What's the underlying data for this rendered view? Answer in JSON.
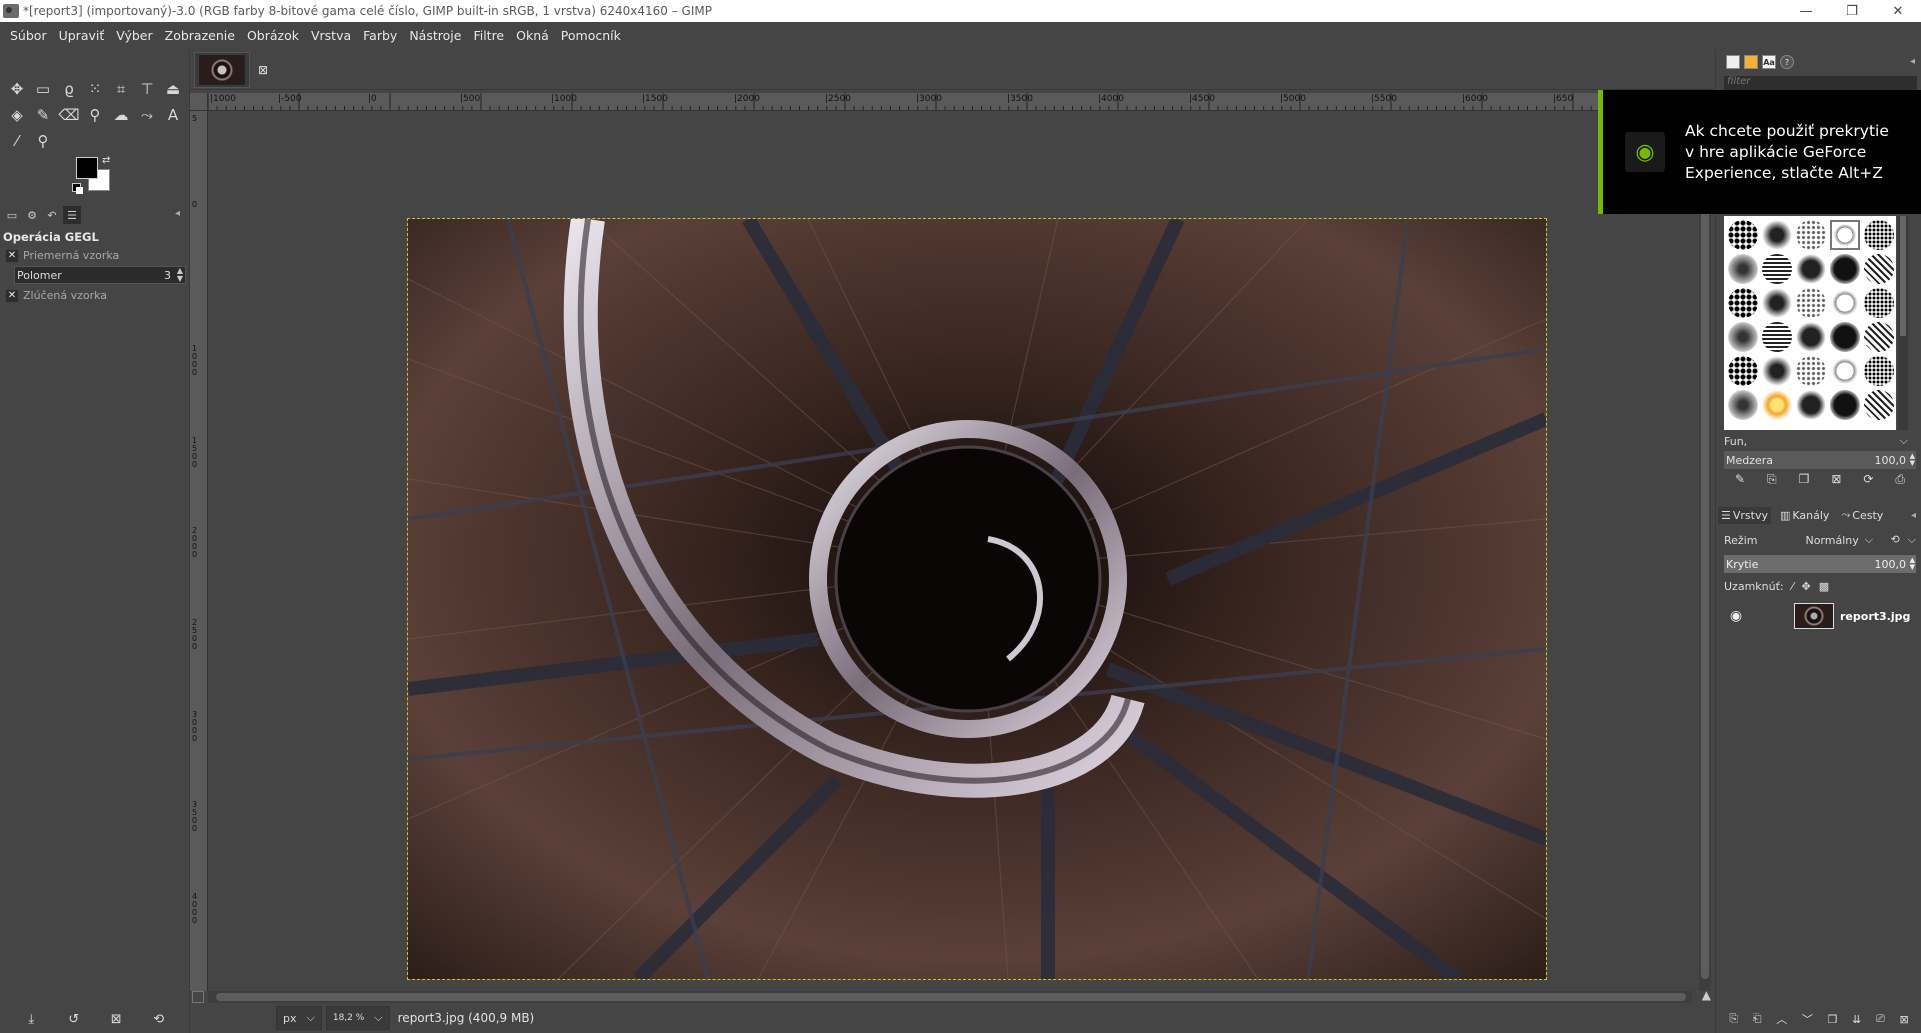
{
  "window": {
    "title": "*[report3] (importovaný)-3.0 (RGB farby 8-bitové gama celé číslo, GIMP built-in sRGB, 1 vrstva) 6240x4160 – GIMP",
    "minimize": "—",
    "maximize": "❐",
    "close": "✕"
  },
  "menu": [
    "Súbor",
    "Upraviť",
    "Výber",
    "Zobrazenie",
    "Obrázok",
    "Vrstva",
    "Farby",
    "Nástroje",
    "Filtre",
    "Okná",
    "Pomocník"
  ],
  "tool_options": {
    "title": "Operácia GEGL",
    "sample_average": "Priemerná vzorka",
    "radius_label": "Polomer",
    "radius_value": "3",
    "sample_merged": "Zlúčená vzorka"
  },
  "canvas": {
    "ruler_h_labels": [
      "|1000",
      "|-500",
      "|0",
      "|500",
      "|1000",
      "|1500",
      "|2000",
      "|2500",
      "|3000",
      "|3500",
      "|4000",
      "|4500",
      "|5000",
      "|5500",
      "|6000",
      "|650"
    ],
    "ruler_v_labels": [
      "5",
      "0",
      "1000",
      "1500",
      "2000",
      "2500",
      "3000",
      "3500",
      "4000"
    ]
  },
  "status": {
    "unit": "px",
    "zoom": "18,2 %",
    "file_info": "report3.jpg (400,9 MB)"
  },
  "brushes": {
    "filter_placeholder": "filter",
    "tag": "Fun,",
    "spacing_label": "Medzera",
    "spacing_value": "100,0"
  },
  "layers": {
    "tabs": [
      "Vrstvy",
      "Kanály",
      "Cesty"
    ],
    "mode_label": "Režim",
    "mode_value": "Normálny",
    "opacity_label": "Krytie",
    "opacity_value": "100,0",
    "lock_label": "Uzamknúť:",
    "layer_name": "report3.jpg"
  },
  "overlay": {
    "message": "Ak chcete použiť prekrytie v hre aplikácie GeForce Experience, stlačte Alt+Z"
  },
  "colors": {
    "accent_nvidia": "#76b900",
    "selection_border": "#d4c21a",
    "ui_bg": "#454545"
  }
}
